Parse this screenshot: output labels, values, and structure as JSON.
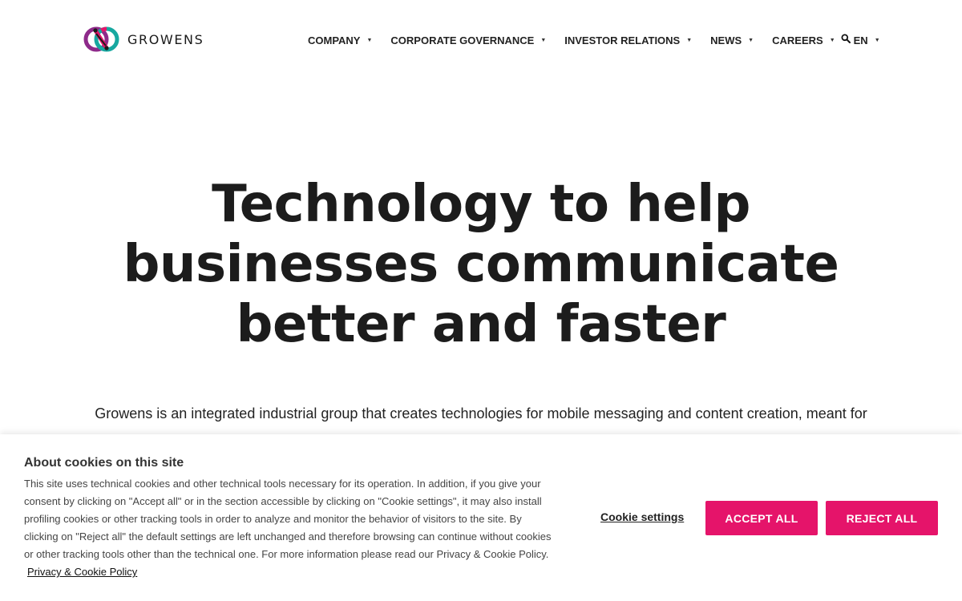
{
  "brand": {
    "name": "GROWENS",
    "accent": "#e5146a"
  },
  "nav": {
    "items": [
      {
        "label": "COMPANY"
      },
      {
        "label": "CORPORATE GOVERNANCE"
      },
      {
        "label": "INVESTOR RELATIONS"
      },
      {
        "label": "NEWS"
      },
      {
        "label": "CAREERS"
      },
      {
        "label": "EN"
      }
    ],
    "caret": "▼",
    "search_icon": "search-icon"
  },
  "hero": {
    "title_lines": [
      "Technology to help",
      "businesses communicate",
      "better and faster"
    ],
    "subtitle": "Growens is an integrated industrial group that creates technologies for mobile messaging and content creation, meant for"
  },
  "cookie": {
    "title": "About cookies on this site",
    "body": "This site uses technical cookies and other technical tools necessary for its operation. In addition, if you give your consent by clicking on \"Accept all\" or in the section accessible by clicking on \"Cookie settings\", it may also install profiling cookies or other tracking tools in order to analyze and monitor the behavior of visitors to the site. By clicking on \"Reject all\" the default settings are left unchanged and therefore browsing can continue without cookies or other tracking tools other than the technical one. For more information please read our Privacy & Cookie Policy.",
    "policy_link": "Privacy & Cookie Policy",
    "settings_label": "Cookie settings",
    "accept_label": "ACCEPT ALL",
    "reject_label": "REJECT ALL"
  }
}
